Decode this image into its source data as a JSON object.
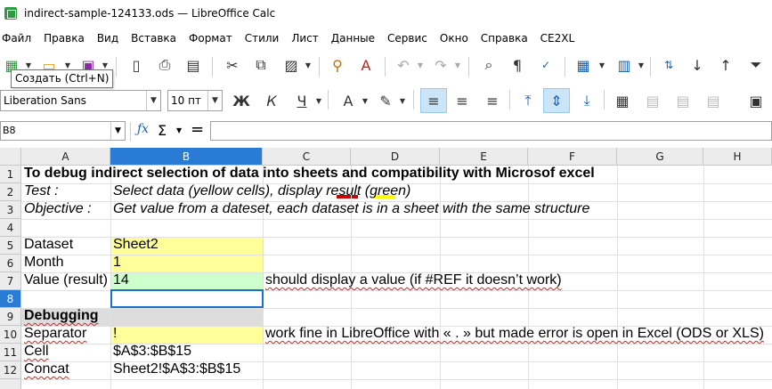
{
  "window": {
    "title": "indirect-sample-124133.ods — LibreOffice Calc"
  },
  "menu": [
    "Файл",
    "Правка",
    "Вид",
    "Вставка",
    "Формат",
    "Стили",
    "Лист",
    "Данные",
    "Сервис",
    "Окно",
    "Справка",
    "CE2XL"
  ],
  "tooltip": "Создать (Ctrl+N)",
  "format_bar": {
    "font_name": "Liberation Sans",
    "font_size": "10 пт",
    "bold_label": "Ж",
    "italic_label": "К",
    "underline_label": "Ч",
    "font_color_label": "A",
    "font_color": "#cc0000",
    "highlight_color": "#ffff00"
  },
  "formula_bar": {
    "name_box": "B8",
    "formula": ""
  },
  "columns": [
    "A",
    "B",
    "C",
    "D",
    "E",
    "F",
    "G",
    "H"
  ],
  "rows": [
    "1",
    "2",
    "3",
    "4",
    "5",
    "6",
    "7",
    "8",
    "9",
    "10",
    "11",
    "12"
  ],
  "selected_cell": "B8",
  "colors": {
    "yellow": "#ffff99",
    "green": "#ccffcc",
    "gray": "#dddddd",
    "selection": "#2a7bd3"
  },
  "cells": {
    "A1": "To debug indirect selection of data into sheets and compatibility with Microsof excel",
    "A2": "Test :",
    "B2": "Select data (yellow cells), display result (green)",
    "A3": "Objective :",
    "B3": "Get value from a dateset, each dataset is in a sheet with the same structure",
    "A5": "Dataset",
    "B5": "Sheet2",
    "A6": "Month",
    "B6": "1",
    "A7": "Value (result)",
    "B7": "14",
    "C7": "should display a value (if #REF it doesn’t work)",
    "A9": "Debugging",
    "A10": "Separator",
    "B10": "!",
    "C10": "work fine in LibreOffice with « . » but made error is open in Excel (ODS or XLS)",
    "A11": "Cell",
    "B11": "$A$3:$B$15",
    "A12": "Concat",
    "B12": "Sheet2!$A$3:$B$15"
  }
}
